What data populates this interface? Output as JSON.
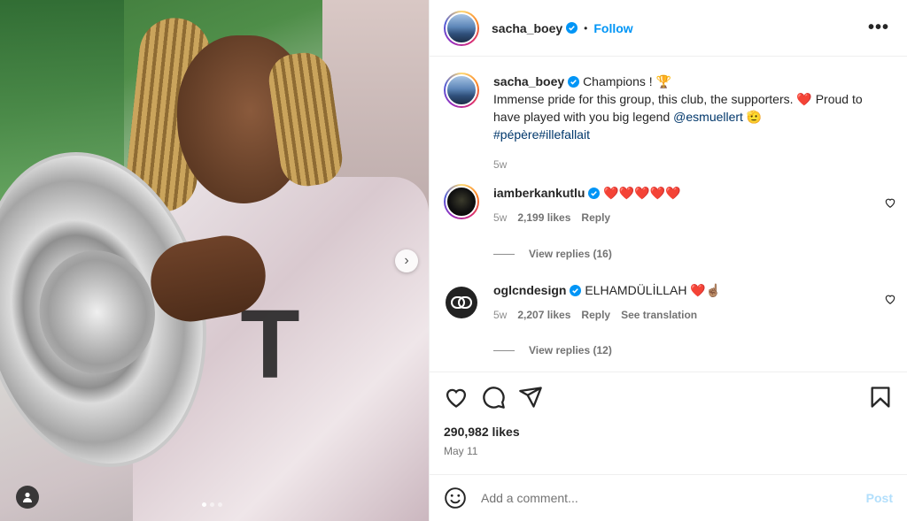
{
  "post": {
    "author": "sacha_boey",
    "follow_label": "Follow",
    "separator": "•",
    "caption_title": "Champions ! 🏆",
    "caption_line1": "Immense pride for this group, this club, the supporters. ❤️ Proud to have played with you big legend ",
    "caption_mention": "@esmuellert",
    "caption_after_mention": " 🫡",
    "caption_tags": "#pépère#illefallait",
    "caption_age": "5w",
    "likes": "290,982 likes",
    "date": "May 11",
    "carousel_total": 3,
    "carousel_index": 1
  },
  "comments": [
    {
      "username": "iamberkankutlu",
      "text": "❤️❤️❤️❤️❤️",
      "age": "5w",
      "likes": "2,199 likes",
      "reply": "Reply",
      "view_replies": "View replies (16)"
    },
    {
      "username": "oglcndesign",
      "text": "ELHAMDÜLİLLAH ❤️☝🏽",
      "age": "5w",
      "likes": "2,207 likes",
      "reply": "Reply",
      "see_translation": "See translation",
      "view_replies": "View replies (12)"
    }
  ],
  "composer": {
    "placeholder": "Add a comment...",
    "post_label": "Post"
  },
  "media": {
    "shirt_logo": "T"
  },
  "icons": {
    "more": "•••",
    "next": "›"
  },
  "colors": {
    "accent": "#0095f6",
    "text": "#262626",
    "muted": "#737373",
    "post_disabled": "#b2dffc"
  }
}
